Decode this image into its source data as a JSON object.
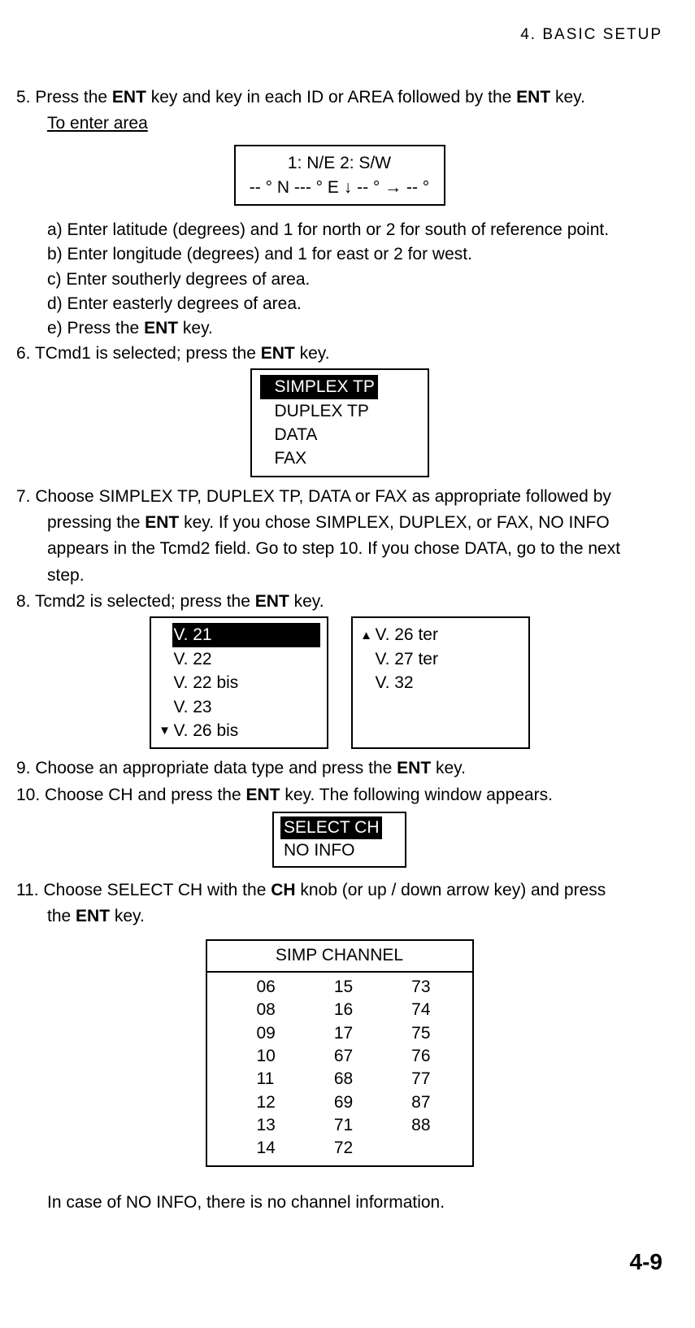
{
  "header": "4.  BASIC  SETUP",
  "step5_pre": "5. Press the ",
  "ent": "ENT",
  "step5_mid": " key and key in each ID or AREA followed by the ",
  "step5_post": " key.",
  "to_enter": "To enter area",
  "box1_line1": "1: N/E      2: S/W",
  "box1_line2": "-- ° N --- ° E ↓ -- ° → -- °",
  "a": "a) Enter latitude (degrees) and 1 for north or 2 for south of reference point.",
  "b": "b) Enter longitude (degrees) and 1 for east or 2 for west.",
  "c": "c) Enter southerly degrees of area.",
  "d": "d) Enter easterly degrees of area.",
  "e_pre": "e) Press the ",
  "e_post": " key.",
  "step6_pre": "6. TCmd1 is selected; press the ",
  "step6_post": " key.",
  "menu1": {
    "i1": "SIMPLEX TP",
    "i2": "DUPLEX TP",
    "i3": "DATA",
    "i4": "FAX"
  },
  "step7_a": "7. Choose SIMPLEX TP, DUPLEX TP, DATA or FAX as appropriate followed by",
  "step7_b_pre": "pressing the ",
  "step7_b_post": " key. If you chose SIMPLEX, DUPLEX, or FAX, NO INFO",
  "step7_c": "appears in the Tcmd2 field. Go to step 10. If you chose DATA, go to the next",
  "step7_d": "step.",
  "step8_pre": "8. Tcmd2 is selected; press the ",
  "step8_post": " key.",
  "vmenu_left": {
    "i1": "V. 21",
    "i2": "V. 22",
    "i3": "V. 22 bis",
    "i4": "V. 23",
    "i5": "V. 26 bis"
  },
  "vmenu_right": {
    "i1": "V. 26 ter",
    "i2": "V. 27 ter",
    "i3": "V. 32"
  },
  "step9_pre": "9. Choose an appropriate data type and press the ",
  "step9_post": " key.",
  "step10_pre": "10. Choose CH and press the ",
  "step10_post": " key. The following window appears.",
  "selbox": {
    "i1": "SELECT CH",
    "i2": "NO INFO"
  },
  "step11_a": "11. Choose SELECT CH with the ",
  "ch": "CH",
  "step11_b": " knob (or up / down arrow key) and press",
  "step11_c_pre": "the ",
  "step11_c_post": " key.",
  "chbox_title": "SIMP CHANNEL",
  "channels": {
    "c1": [
      "06",
      "08",
      "09",
      "10",
      "11",
      "12",
      "13",
      "14"
    ],
    "c2": [
      "15",
      "16",
      "17",
      "67",
      "68",
      "69",
      "71",
      "72"
    ],
    "c3": [
      "73",
      "74",
      "75",
      "76",
      "77",
      "87",
      "88"
    ]
  },
  "noinfo_note": "In case of NO INFO, there is no channel information.",
  "pagenum": "4-9"
}
